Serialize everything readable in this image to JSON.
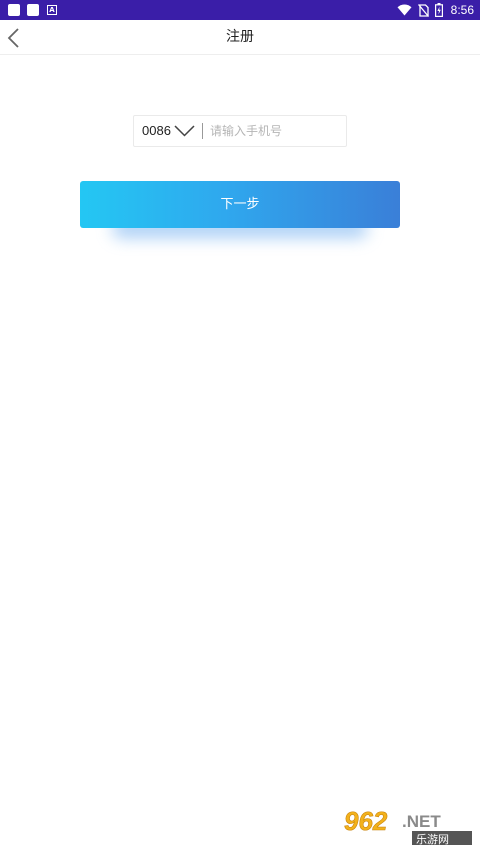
{
  "status_bar": {
    "time": "8:56",
    "left_icons": [
      "app-square-icon",
      "app-square-icon",
      "font-a-icon"
    ],
    "right_icons": [
      "wifi-icon",
      "no-sim-icon",
      "battery-icon"
    ],
    "background": "#3a1ea8"
  },
  "nav": {
    "back_icon": "chevron-left-icon",
    "title": "注册"
  },
  "form": {
    "country_code": "0086",
    "dropdown_icon": "chevron-down-icon",
    "phone_placeholder": "请输入手机号",
    "phone_value": ""
  },
  "next_button": {
    "label": "下一步",
    "gradient": [
      "#24c7f3",
      "#3a7fd8"
    ]
  },
  "watermark": {
    "brand": "962.NET",
    "sub": "乐游网"
  }
}
